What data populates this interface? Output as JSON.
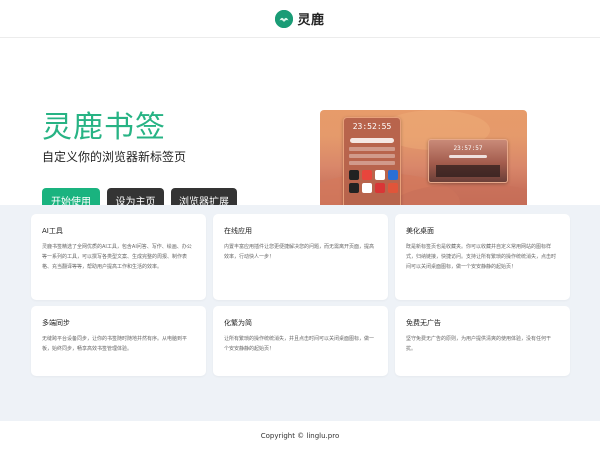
{
  "header": {
    "brand_name": "灵鹿",
    "logo_icon": "deer-logo-icon",
    "accent": "#1a9c76"
  },
  "hero": {
    "title": "灵鹿书签",
    "subtitle": "自定义你的浏览器新标签页",
    "buttons": {
      "start": "开始使用",
      "set_home": "设为主页",
      "extension": "浏览器扩展"
    },
    "preview": {
      "phone_time": "23:52:55",
      "desktop_time": "23:57:57"
    }
  },
  "features": [
    {
      "title": "AI工具",
      "desc": "灵鹿书签精选了全网优质的AI工具，包含AI问答、写作、绘画、办公等一系列的工具，可以撰写各类型文案、生成完整的周报、制作表格、充当翻译等等，帮助用户提高工作和生活的效率。"
    },
    {
      "title": "在线应用",
      "desc": "内置丰富应用插件让您更便捷解决您的问题，而无需离开页面，提高效率，行动快人一步！"
    },
    {
      "title": "美化桌面",
      "desc": "既是新标签页也是收藏夹。你可以收藏并自定义常用网站的图标样式，归纳链接，快捷访问。支持让所有繁琐的操作统统消失，点击时间可以关闭桌面图标，做一个安安静静的起始页！"
    },
    {
      "title": "多端同步",
      "desc": "无缝跨平台设备同步，让你的书签随时随地井然有序。从电脑到平板，始终同步，畅享高效书签管理体验。"
    },
    {
      "title": "化繁为简",
      "desc": "让所有繁琐的操作统统消失，并且点击时间可以关闭桌面图标，做一个安安静静的起始页！"
    },
    {
      "title": "免费无广告",
      "desc": "坚守免费无广告的原则，为用户提供清爽的使用体验，没有任何干扰。"
    }
  ],
  "footer": {
    "copyright": "Copyright © linglu.pro"
  }
}
